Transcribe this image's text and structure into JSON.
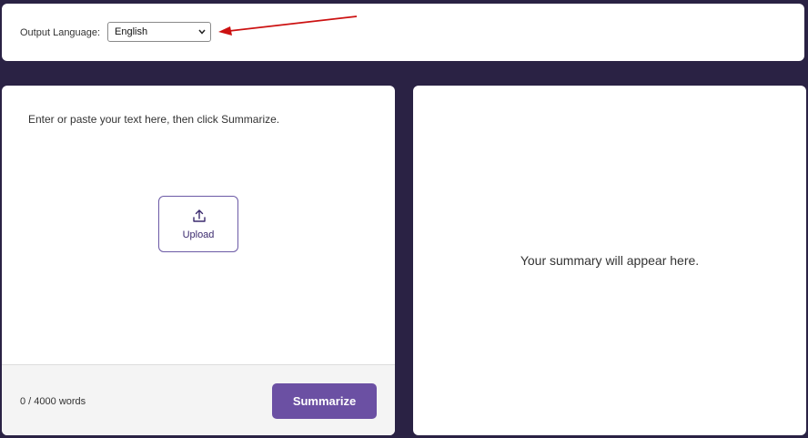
{
  "language": {
    "label": "Output Language:",
    "selected": "English"
  },
  "input": {
    "placeholder": "Enter or paste your text here, then click Summarize.",
    "upload_label": "Upload",
    "word_count": "0 / 4000 words",
    "summarize_label": "Summarize"
  },
  "output": {
    "placeholder": "Your summary will appear here."
  },
  "colors": {
    "background": "#2a2244",
    "accent": "#6b50a3",
    "annotation": "#cc1111"
  },
  "icons": {
    "dropdown": "chevron-down-icon",
    "upload": "upload-icon",
    "annotation": "arrow-annotation-icon"
  }
}
